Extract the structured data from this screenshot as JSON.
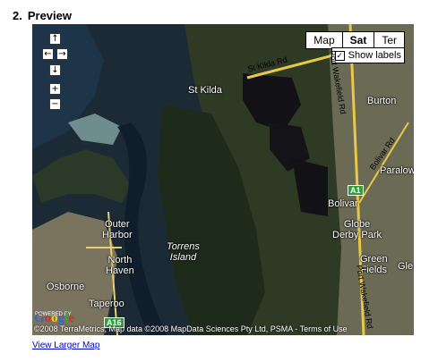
{
  "section": {
    "number": "2.",
    "title": "Preview"
  },
  "map": {
    "type_buttons": [
      "Map",
      "Sat",
      "Ter"
    ],
    "active_type": "Sat",
    "show_labels": "Show labels",
    "nav": {
      "up": "↑",
      "left": "←",
      "right": "→",
      "down": "↓",
      "zoom_in": "+",
      "zoom_out": "−"
    },
    "places": {
      "st_kilda": "St Kilda",
      "burton": "Burton",
      "paralowie": "Paralowie",
      "bolivar": "Bolivar",
      "globe_derby_park": "Globe\nDerby Park",
      "outer_harbor": "Outer\nHarbor",
      "north_haven": "North\nHaven",
      "torrens_island": "Torrens\nIsland",
      "osborne": "Osborne",
      "taperoo": "Taperoo",
      "green_fields": "Green\nFields",
      "gle": "Gle"
    },
    "roads": {
      "st_kilda_rd": "St Kilda Rd",
      "port_wakefield_rd": "Port Wakefield Rd",
      "bolivar_rd": "Bolivar Rd"
    },
    "shields": {
      "a1": "A1",
      "a16": "A16"
    },
    "powered_by": "POWERED BY",
    "google": [
      "G",
      "o",
      "o",
      "g",
      "l",
      "e"
    ],
    "google_colors": [
      "#3366cc",
      "#cc3333",
      "#ffcc00",
      "#3366cc",
      "#33aa33",
      "#cc3333"
    ],
    "attribution": "©2008 TerraMetrics, Map data ©2008 MapData Sciences Pty Ltd, PSMA - Terms of Use"
  },
  "link": "View Larger Map"
}
